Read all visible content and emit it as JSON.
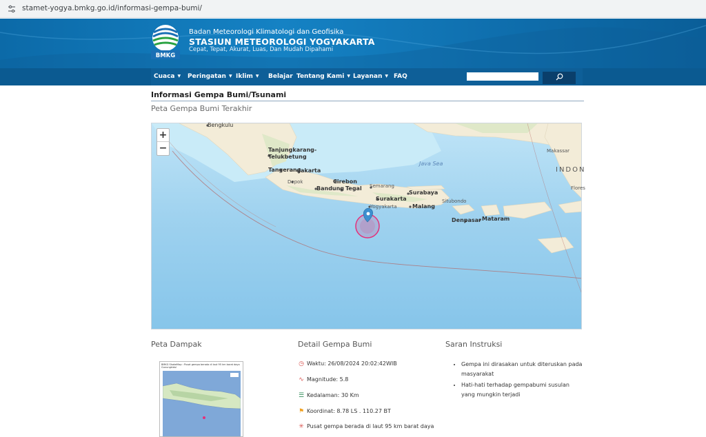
{
  "browser": {
    "url": "stamet-yogya.bmkg.go.id/informasi-gempa-bumi/"
  },
  "header": {
    "logo_text": "BMKG",
    "org_name": "Badan Meteorologi Klimatologi dan Geofisika",
    "station_name": "STASIUN METEOROLOGI YOGYAKARTA",
    "tagline": "Cepat, Tepat, Akurat, Luas, Dan Mudah Dipahami"
  },
  "nav": {
    "items": [
      {
        "label": "Cuaca",
        "dropdown": true
      },
      {
        "label": "Peringatan",
        "dropdown": true
      },
      {
        "label": "Iklim",
        "dropdown": true
      },
      {
        "label": "Belajar",
        "dropdown": false
      },
      {
        "label": "Tentang Kami",
        "dropdown": true
      },
      {
        "label": "Layanan",
        "dropdown": true
      },
      {
        "label": "FAQ",
        "dropdown": false
      }
    ],
    "search_icon": "search-icon"
  },
  "page": {
    "title": "Informasi Gempa Bumi/Tsunami",
    "map_section": "Peta Gempa Bumi Terakhir",
    "zoom_in": "+",
    "zoom_out": "−"
  },
  "map": {
    "labels": {
      "bengkulu": "Bengkulu",
      "tanjungkarang": "Tanjungkarang-",
      "telukbetung": "Telukbetung",
      "tangerang": "Tangerang",
      "jakarta": "Jakarta",
      "depok": "Depok",
      "cirebon": "Cirebon",
      "bandung": "Bandung",
      "tegal": "Tegal",
      "semarang": "Semarang",
      "surabaya": "Surabaya",
      "surakarta": "Surakarta",
      "yogyakarta": "Yogyakarta",
      "malang": "Malang",
      "situbondo": "Situbondo",
      "denpasar": "Denpasar",
      "mataram": "Mataram",
      "java_sea": "Java Sea",
      "indonesia": "INDON",
      "makassar": "Makassar",
      "flores": "Flores"
    }
  },
  "impact": {
    "heading": "Peta Dampak",
    "image_title": "BMKG ShakeMap : Pusat gempa berada di laut 95 km barat daya Gunungkidul"
  },
  "detail": {
    "heading": "Detail Gempa Bumi",
    "waktu": "Waktu: 26/08/2024 20:02:42WIB",
    "magnitude": "Magnitude: 5.8",
    "kedalaman": "Kedalaman: 30 Km",
    "koordinat": "Koordinat: 8.78 LS . 110.27 BT",
    "pusat": "Pusat gempa berada di laut 95 km barat daya"
  },
  "advice": {
    "heading": "Saran Instruksi",
    "items": [
      "Gempa ini dirasakan untuk diteruskan pada masyarakat",
      "Hati-hati terhadap gempabumi susulan yang mungkin terjadi"
    ]
  },
  "colors": {
    "banner": "#1582c4",
    "nav": "#0e5f98",
    "sea": "#a9d9f4",
    "land": "#f3ecd8",
    "epicenter": "#e4307a",
    "marker": "#3d8fcf"
  }
}
